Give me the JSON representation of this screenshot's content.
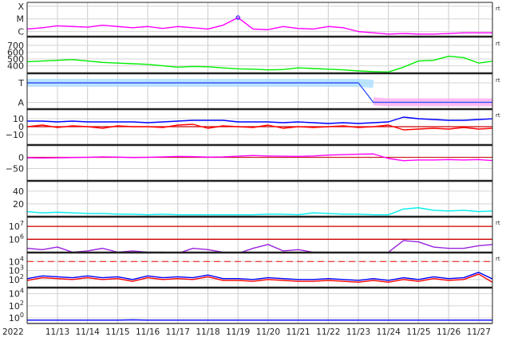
{
  "chart_data": [
    {
      "type": "line",
      "id": "xray",
      "title": "",
      "yticks": [
        {
          "v": -6,
          "label": "C"
        },
        {
          "v": -5,
          "label": "M"
        },
        {
          "v": -4,
          "label": "X"
        }
      ],
      "ylim": [
        -6.4,
        -3.7
      ],
      "rt": "rt",
      "series": [
        {
          "name": "xray-flux",
          "color": "#ff00ff",
          "values": [
            -5.8,
            -5.7,
            -5.55,
            -5.6,
            -5.65,
            -5.5,
            -5.6,
            -5.7,
            -5.6,
            -5.75,
            -5.6,
            -5.7,
            -5.8,
            -5.5,
            -4.9,
            -5.8,
            -5.85,
            -5.6,
            -5.75,
            -5.8,
            -5.6,
            -5.7,
            -6.0,
            -6.1,
            -6.2,
            -6.15,
            -6.2,
            -6.2,
            -6.15,
            -6.1,
            -6.1,
            -6.1
          ]
        }
      ],
      "marker": {
        "t": 7.0,
        "v": -4.9,
        "color": "#3333ff"
      }
    },
    {
      "type": "line",
      "id": "speed",
      "yticks": [
        {
          "v": 400,
          "label": "400"
        },
        {
          "v": 500,
          "label": "500"
        },
        {
          "v": 600,
          "label": "600"
        },
        {
          "v": 700,
          "label": "700"
        }
      ],
      "ylim": [
        290,
        815
      ],
      "rt": "rt",
      "series": [
        {
          "name": "solar-wind-speed",
          "color": "#00ee00",
          "values": [
            460,
            470,
            480,
            490,
            470,
            450,
            440,
            430,
            420,
            400,
            380,
            390,
            385,
            370,
            355,
            350,
            340,
            345,
            370,
            360,
            350,
            340,
            325,
            315,
            310,
            380,
            470,
            480,
            540,
            520,
            440,
            470
          ]
        }
      ]
    },
    {
      "type": "line",
      "id": "source",
      "yticks": [
        {
          "v": 0,
          "label": "A"
        },
        {
          "v": 1,
          "label": "T"
        }
      ],
      "ylim": [
        -0.35,
        1.45
      ],
      "rt": "rt",
      "series": [
        {
          "name": "source-T-points",
          "color": "#aaddff",
          "band": true,
          "values": [
            1,
            1,
            1,
            1,
            1,
            1,
            1,
            1,
            1,
            1,
            1,
            1,
            1,
            1,
            1,
            1,
            1,
            1,
            1,
            1,
            1,
            1,
            1,
            0.95,
            null,
            null,
            null,
            null,
            null,
            null,
            null,
            null
          ]
        },
        {
          "name": "source-A-points",
          "color": "#ffaaee",
          "band": true,
          "values": [
            null,
            null,
            null,
            null,
            null,
            null,
            null,
            null,
            null,
            null,
            null,
            null,
            null,
            null,
            null,
            null,
            null,
            null,
            null,
            null,
            null,
            null,
            null,
            0.05,
            0,
            0,
            0,
            0,
            0,
            0,
            0,
            0
          ]
        },
        {
          "name": "source-selected",
          "color": "#3355ff",
          "values": [
            1,
            1,
            1,
            1,
            1,
            1,
            1,
            1,
            1,
            1,
            1,
            1,
            1,
            1,
            1,
            1,
            1,
            1,
            1,
            1,
            1,
            1,
            1,
            0,
            0,
            0,
            0,
            0,
            0,
            0,
            0,
            0
          ]
        }
      ]
    },
    {
      "type": "line",
      "id": "bfield",
      "yticks": [
        {
          "v": -10,
          "label": "−10"
        },
        {
          "v": 0,
          "label": "0"
        },
        {
          "v": 10,
          "label": "10"
        }
      ],
      "ylim": [
        -23,
        22
      ],
      "rt": "rt",
      "hline": {
        "v": 0,
        "color": "#cc0000"
      },
      "series": [
        {
          "name": "bt",
          "color": "#0000ff",
          "values": [
            7,
            7,
            6,
            7,
            6,
            6,
            6,
            6,
            5,
            6,
            7,
            8,
            8,
            8,
            6,
            6,
            6,
            5,
            6,
            5,
            4,
            5,
            4,
            5,
            6,
            12,
            10,
            9,
            8,
            8,
            9,
            10
          ]
        },
        {
          "name": "bz",
          "color": "#ff0000",
          "values": [
            0,
            2,
            -1,
            1,
            0,
            -2,
            1,
            0,
            0,
            -1,
            2,
            3,
            -2,
            1,
            0,
            -1,
            2,
            -2,
            0,
            -1,
            0,
            1,
            -1,
            0,
            2,
            -4,
            -3,
            -2,
            -3,
            -1,
            -3,
            -2
          ]
        }
      ]
    },
    {
      "type": "line",
      "id": "phi",
      "yticks": [
        {
          "v": -50,
          "label": "−50"
        },
        {
          "v": 0,
          "label": "0"
        }
      ],
      "ylim": [
        -105,
        55
      ],
      "hline": {
        "v": 0,
        "color": "#cc2222"
      },
      "series": [
        {
          "name": "phi-angle",
          "color": "#ff00ff",
          "values": [
            -2,
            -3,
            -2,
            -1,
            0,
            2,
            1,
            -1,
            0,
            2,
            4,
            3,
            1,
            2,
            5,
            8,
            6,
            5,
            4,
            6,
            10,
            12,
            14,
            15,
            -5,
            -15,
            -12,
            -12,
            -10,
            -12,
            -10,
            -15
          ]
        }
      ]
    },
    {
      "type": "line",
      "id": "density",
      "yticks": [
        {
          "v": 20,
          "label": "20"
        },
        {
          "v": 40,
          "label": "40"
        }
      ],
      "ylim": [
        0,
        56
      ],
      "series": [
        {
          "name": "density",
          "color": "#00eeee",
          "values": [
            8,
            6,
            7,
            6,
            5,
            5,
            4,
            4,
            3,
            4,
            3,
            3,
            3,
            3,
            3,
            3,
            4,
            4,
            3,
            6,
            5,
            4,
            4,
            3,
            3,
            12,
            14,
            10,
            9,
            10,
            8,
            9
          ]
        }
      ]
    },
    {
      "type": "line",
      "id": "electrons",
      "yticks": [
        {
          "v": 6,
          "label": "10",
          "sup": "6"
        },
        {
          "v": 7,
          "label": "10",
          "sup": "7"
        }
      ],
      "ylim": [
        4.97,
        7.75
      ],
      "rt": "rt",
      "hlines": [
        {
          "v": 6,
          "color": "#cc0000"
        },
        {
          "v": 7,
          "color": "#cc0000"
        }
      ],
      "series": [
        {
          "name": "electron-flux",
          "color": "#9922dd",
          "values": [
            5.3,
            5.2,
            5.4,
            5.0,
            5.1,
            5.3,
            5.0,
            5.1,
            5.0,
            5.0,
            4.9,
            5.3,
            5.2,
            5.0,
            4.9,
            5.3,
            5.6,
            5.1,
            5.2,
            5.0,
            5.0,
            4.9,
            4.9,
            4.9,
            5.0,
            5.9,
            5.8,
            5.4,
            5.3,
            5.3,
            5.5,
            5.6
          ]
        }
      ]
    },
    {
      "type": "line",
      "id": "protons",
      "yticks": [
        {
          "v": 2,
          "label": "10",
          "sup": "2"
        },
        {
          "v": 3,
          "label": "10",
          "sup": "3"
        },
        {
          "v": 4,
          "label": "10",
          "sup": "4"
        }
      ],
      "ylim": [
        1.1,
        5.0
      ],
      "rt": "rt",
      "hline": {
        "v": 4,
        "color": "#ee3333",
        "dashed": true
      },
      "series": [
        {
          "name": "proton-flux-blue",
          "color": "#0000ff",
          "values": [
            2.1,
            2.4,
            2.3,
            2.2,
            2.4,
            2.2,
            2.3,
            2.0,
            2.4,
            2.2,
            2.3,
            2.2,
            2.5,
            2.1,
            2.1,
            2.0,
            2.2,
            2.1,
            2.0,
            2.0,
            2.1,
            2.0,
            1.9,
            2.1,
            1.9,
            2.2,
            2.0,
            2.3,
            2.1,
            2.2,
            2.8,
            2.0
          ]
        },
        {
          "name": "proton-flux-red",
          "color": "#ff0000",
          "values": [
            1.9,
            2.2,
            2.1,
            2.0,
            2.2,
            2.0,
            2.1,
            1.8,
            2.2,
            2.0,
            2.1,
            2.0,
            2.3,
            1.9,
            1.9,
            1.8,
            2.0,
            1.9,
            1.8,
            1.8,
            1.9,
            1.8,
            1.7,
            1.9,
            1.7,
            2.0,
            1.8,
            2.1,
            1.9,
            2.0,
            2.6,
            1.6
          ]
        }
      ]
    },
    {
      "type": "line",
      "id": "highenergy",
      "yticks": [
        {
          "v": 0,
          "label": "10",
          "sup": "0"
        },
        {
          "v": 2,
          "label": "10",
          "sup": "2"
        },
        {
          "v": 4,
          "label": "10",
          "sup": "4"
        }
      ],
      "ylim": [
        -0.9,
        5.0
      ],
      "series": [
        {
          "name": "high-energy-flux",
          "color": "#0000ff",
          "values": [
            -0.35,
            -0.35,
            -0.35,
            -0.35,
            -0.35,
            -0.35,
            -0.35,
            -0.3,
            -0.35,
            -0.35,
            -0.35,
            -0.35,
            -0.35,
            -0.35,
            -0.35,
            -0.35,
            -0.35,
            -0.35,
            -0.35,
            -0.35,
            -0.35,
            -0.35,
            -0.35,
            -0.35,
            -0.35,
            -0.35,
            -0.35,
            -0.35,
            -0.35,
            -0.35,
            -0.35,
            -0.35
          ]
        }
      ]
    }
  ],
  "time_axis": {
    "start_label": "2022",
    "step_days": 0.5,
    "labels": [
      "11/13",
      "11/14",
      "11/15",
      "11/16",
      "11/17",
      "11/18",
      "11/19",
      "11/20",
      "11/21",
      "11/22",
      "11/23",
      "11/24",
      "11/25",
      "11/26",
      "11/27"
    ]
  }
}
